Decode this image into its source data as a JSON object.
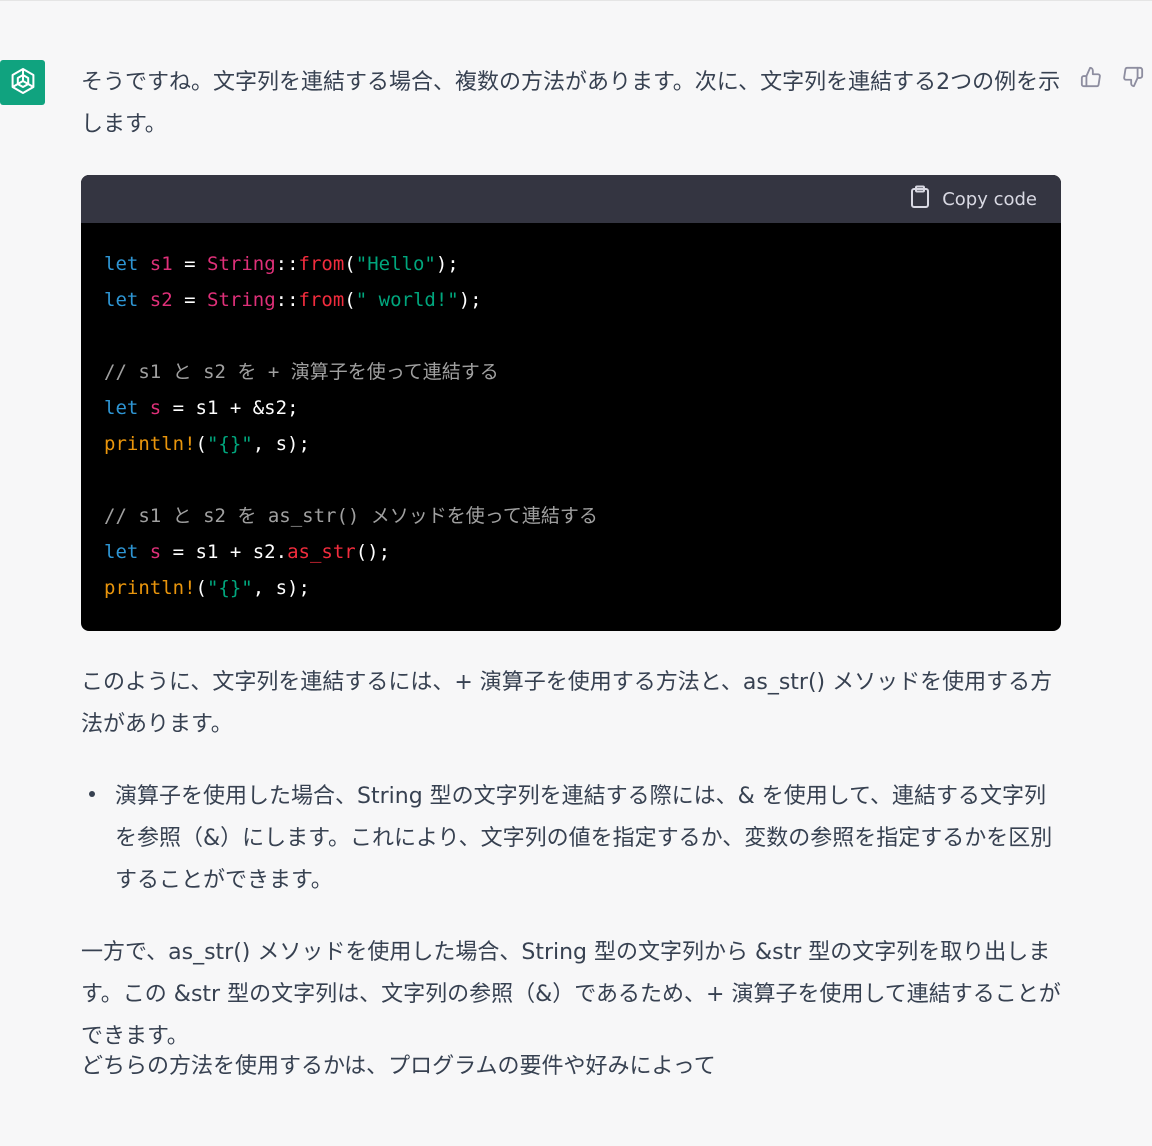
{
  "message": {
    "intro": "そうですね。文字列を連結する場合、複数の方法があります。次に、文字列を連結する2つの例を示します。",
    "summary": "このように、文字列を連結するには、+ 演算子を使用する方法と、as_str() メソッドを使用する方法があります。",
    "bullet": "演算子を使用した場合、String 型の文字列を連結する際には、& を使用して、連結する文字列を参照（&）にします。これにより、文字列の値を指定するか、変数の参照を指定するかを区別することができます。",
    "oneway": "一方で、as_str() メソッドを使用した場合、String 型の文字列から &str 型の文字列を取り出します。この &str 型の文字列は、文字列の参照（&）であるため、+ 演算子を使用して連結することができます。",
    "which": "どちらの方法を使用するかは、プログラムの要件や好みによって"
  },
  "code": {
    "copy_label": "Copy code",
    "lines": [
      [
        [
          "kw",
          "let"
        ],
        [
          "pun",
          " "
        ],
        [
          "var",
          "s1"
        ],
        [
          "pun",
          " = "
        ],
        [
          "type",
          "String"
        ],
        [
          "pun",
          "::"
        ],
        [
          "fn",
          "from"
        ],
        [
          "pun",
          "("
        ],
        [
          "str",
          "\"Hello\""
        ],
        [
          "pun",
          ");"
        ]
      ],
      [
        [
          "kw",
          "let"
        ],
        [
          "pun",
          " "
        ],
        [
          "var",
          "s2"
        ],
        [
          "pun",
          " = "
        ],
        [
          "type",
          "String"
        ],
        [
          "pun",
          "::"
        ],
        [
          "fn",
          "from"
        ],
        [
          "pun",
          "("
        ],
        [
          "str",
          "\" world!\""
        ],
        [
          "pun",
          ");"
        ]
      ],
      [],
      [
        [
          "com",
          "// s1 と s2 を + 演算子を使って連結する"
        ]
      ],
      [
        [
          "kw",
          "let"
        ],
        [
          "pun",
          " "
        ],
        [
          "var",
          "s"
        ],
        [
          "pun",
          " = s1 + &s2;"
        ]
      ],
      [
        [
          "macro",
          "println!"
        ],
        [
          "pun",
          "("
        ],
        [
          "str",
          "\"{}\""
        ],
        [
          "pun",
          ", s);"
        ]
      ],
      [],
      [
        [
          "com",
          "// s1 と s2 を as_str() メソッドを使って連結する"
        ]
      ],
      [
        [
          "kw",
          "let"
        ],
        [
          "pun",
          " "
        ],
        [
          "var",
          "s"
        ],
        [
          "pun",
          " = s1 + s2."
        ],
        [
          "fn",
          "as_str"
        ],
        [
          "pun",
          "();"
        ]
      ],
      [
        [
          "macro",
          "println!"
        ],
        [
          "pun",
          "("
        ],
        [
          "str",
          "\"{}\""
        ],
        [
          "pun",
          ", s);"
        ]
      ]
    ]
  },
  "icons": {
    "avatar": "openai-logo-icon",
    "thumbs_up": "thumbs-up-icon",
    "thumbs_down": "thumbs-down-icon",
    "copy": "clipboard-icon"
  },
  "colors": {
    "avatar_bg": "#10a37f",
    "code_header_bg": "#343541",
    "code_bg": "#000000",
    "text": "#374151",
    "page_bg": "#f7f7f8"
  }
}
